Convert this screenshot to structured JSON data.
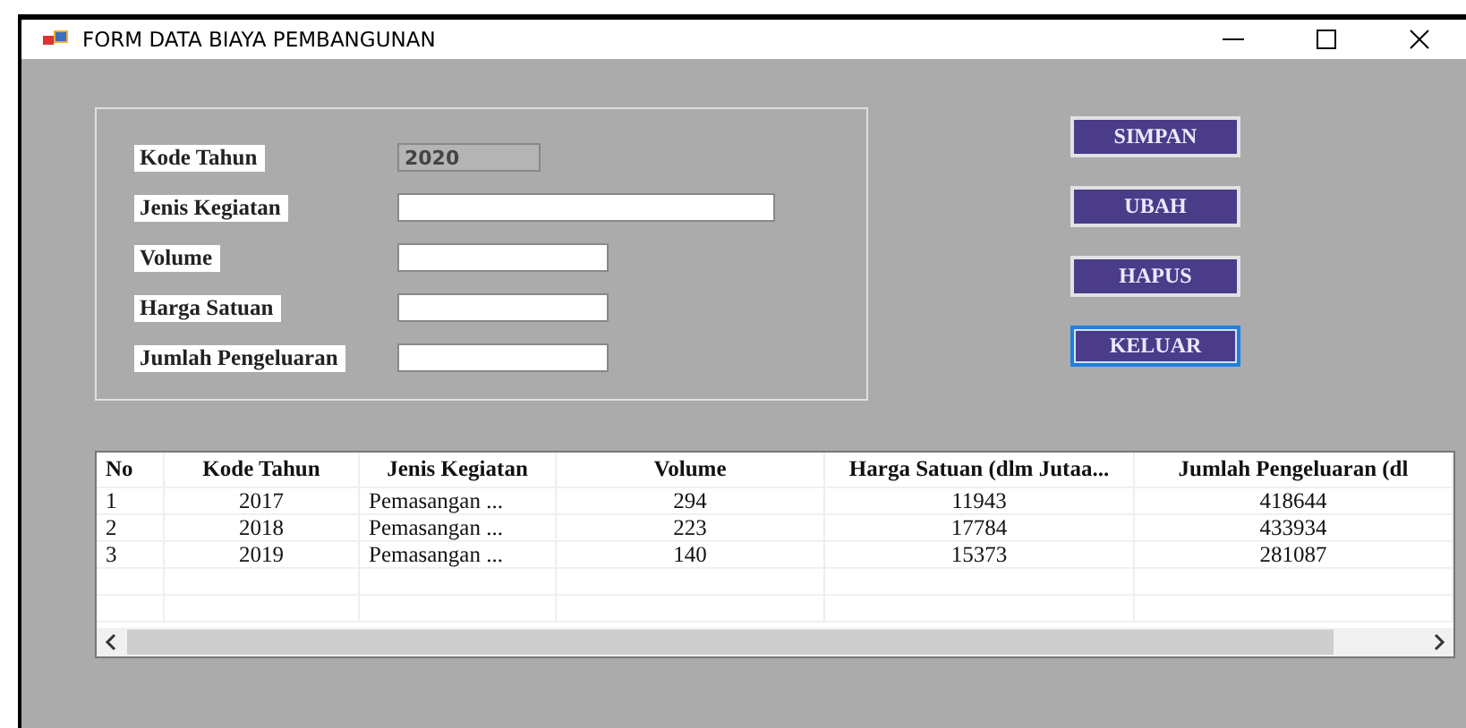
{
  "window": {
    "title": "FORM DATA BIAYA PEMBANGUNAN"
  },
  "fields": [
    {
      "label": "Kode Tahun",
      "value": "2020",
      "disabled": true
    },
    {
      "label": "Jenis Kegiatan",
      "disabled": false
    },
    {
      "label": "Volume",
      "disabled": false
    },
    {
      "label": "Harga Satuan",
      "disabled": false
    },
    {
      "label": "Jumlah Pengeluaran",
      "disabled": false
    }
  ],
  "buttons": [
    {
      "label": "SIMPAN",
      "focused": false
    },
    {
      "label": "UBAH",
      "focused": false
    },
    {
      "label": "HAPUS",
      "focused": false
    },
    {
      "label": "KELUAR",
      "focused": true
    }
  ],
  "table": {
    "columns": [
      "No",
      "Kode Tahun",
      "Jenis Kegiatan",
      "Volume",
      "Harga Satuan (dlm Jutaa...",
      "Jumlah Pengeluaran (dl"
    ],
    "rows": [
      [
        "1",
        "2017",
        "Pemasangan ...",
        "294",
        "11943",
        "418644"
      ],
      [
        "2",
        "2018",
        "Pemasangan ...",
        "223",
        "17784",
        "433934"
      ],
      [
        "3",
        "2019",
        "Pemasangan ...",
        "140",
        "15373",
        "281087"
      ]
    ]
  }
}
